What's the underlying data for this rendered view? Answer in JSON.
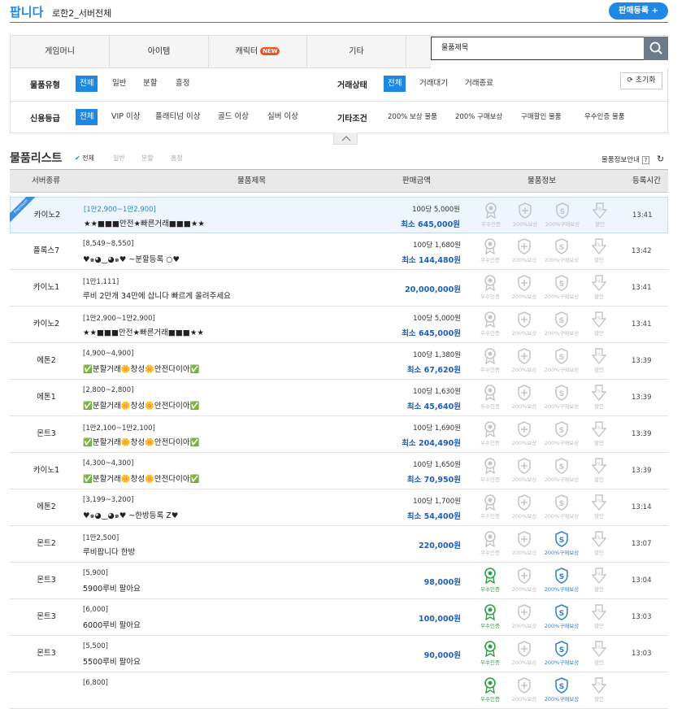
{
  "header": {
    "title": "팝니다",
    "server": "로한2_서버전체",
    "register_btn": "판매등록 +"
  },
  "categories": [
    {
      "label": "게임머니"
    },
    {
      "label": "아이템"
    },
    {
      "label": "캐릭터",
      "badge": "NEW"
    },
    {
      "label": "기타"
    }
  ],
  "search": {
    "value": "물품제목"
  },
  "filter": {
    "item_type": {
      "label": "물품유형",
      "options": [
        "전체",
        "일반",
        "분할",
        "흥정"
      ],
      "selected": "전체"
    },
    "trade_status": {
      "label": "거래상태",
      "options": [
        "전체",
        "거래대기",
        "거래종료"
      ],
      "selected": "전체"
    },
    "reset": "초기화",
    "credit": {
      "label": "신용등급",
      "options": [
        "전체",
        "VIP 이상",
        "플래티넘 이상",
        "골드 이상",
        "실버 이상"
      ],
      "selected": "전체"
    },
    "etc": {
      "label": "기타조건",
      "options": [
        "200% 보상 물품",
        "200% 구매보상",
        "구매할인 물품",
        "우수인증 물품"
      ]
    }
  },
  "list": {
    "title": "물품리스트",
    "types": [
      "전체",
      "일반",
      "분할",
      "흥정"
    ],
    "info_link": "물품정보안내",
    "columns": [
      "서버종류",
      "물품제목",
      "판매금액",
      "물품정보",
      "등록시간"
    ]
  },
  "badge_labels": [
    "우수인증",
    "200%보상",
    "200%구매보상",
    "할인"
  ],
  "premium_label": "Premium",
  "rows": [
    {
      "server": "카이노2",
      "range": "[1만2,900~1만2,900]",
      "title": "★★■■■안전★빠른거래■■■★★",
      "unit": "100당 5,000원",
      "min": "최소 645,000원",
      "time": "13:41",
      "premium": true
    },
    {
      "server": "플록스7",
      "range": "[8,549~8,550]",
      "title": "♥๑◕‿◕๑♥ ~분할등록 ○♥",
      "unit": "100당 1,680원",
      "min": "최소 144,480원",
      "time": "13:42"
    },
    {
      "server": "카이노1",
      "range": "[1만1,111]",
      "title": "루비 2만개 34만에 삽니다 빠르게 올려주세요",
      "total": "20,000,000원",
      "time": "13:41"
    },
    {
      "server": "카이노2",
      "range": "[1만2,900~1만2,900]",
      "title": "★★■■■안전★빠른거래■■■★★",
      "unit": "100당 5,000원",
      "min": "최소 645,000원",
      "time": "13:41"
    },
    {
      "server": "에톤2",
      "range": "[4,900~4,900]",
      "title": "✅분할거래🌼창성🌼안전다이아✅",
      "unit": "100당 1,380원",
      "min": "최소 67,620원",
      "time": "13:39"
    },
    {
      "server": "에톤1",
      "range": "[2,800~2,800]",
      "title": "✅분할거래🌼창성🌼안전다이아✅",
      "unit": "100당 1,630원",
      "min": "최소 45,640원",
      "time": "13:39"
    },
    {
      "server": "몬트3",
      "range": "[1만2,100~1만2,100]",
      "title": "✅분할거래🌼창성🌼안전다이아✅",
      "unit": "100당 1,690원",
      "min": "최소 204,490원",
      "time": "13:39"
    },
    {
      "server": "카이노1",
      "range": "[4,300~4,300]",
      "title": "✅분할거래🌼창성🌼안전다이아✅",
      "unit": "100당 1,650원",
      "min": "최소 70,950원",
      "time": "13:39"
    },
    {
      "server": "에톤2",
      "range": "[3,199~3,200]",
      "title": "♥๑◕‿◕๑♥ ~한방등록 Z♥",
      "unit": "100당 1,700원",
      "min": "최소 54,400원",
      "time": "13:14"
    },
    {
      "server": "몬트2",
      "range": "[1만2,500]",
      "title": "루비팝니다 한방",
      "total": "220,000원",
      "time": "13:07",
      "blue_compensation": true
    },
    {
      "server": "몬트3",
      "range": "[5,900]",
      "title": "5900루비 팔아요",
      "total": "98,000원",
      "time": "13:04",
      "cert": true,
      "blue_compensation": true
    },
    {
      "server": "몬트3",
      "range": "[6,000]",
      "title": "6000루비 팔아요",
      "total": "100,000원",
      "time": "13:03",
      "cert": true,
      "blue_compensation": true
    },
    {
      "server": "몬트3",
      "range": "[5,500]",
      "title": "5500루비 팔아요",
      "total": "90,000원",
      "time": "13:03",
      "cert": true,
      "blue_compensation": true
    },
    {
      "server": "",
      "range": "[6,800]",
      "title": "",
      "total": "",
      "time": "",
      "cert": true,
      "blue_compensation": true
    }
  ]
}
